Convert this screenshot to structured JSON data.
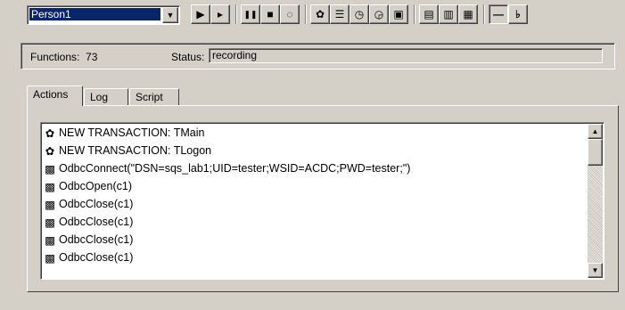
{
  "toolbar": {
    "person_value": "Person1",
    "buttons": [
      {
        "name": "play-icon",
        "glyph": "▶"
      },
      {
        "name": "step-play-icon",
        "glyph": "▸"
      },
      {
        "name": "pause-icon",
        "glyph": "❚❚"
      },
      {
        "name": "stop-icon",
        "glyph": "■"
      },
      {
        "name": "record-icon",
        "glyph": "◌"
      },
      {
        "name": "gears-icon",
        "glyph": "✿"
      },
      {
        "name": "properties-icon",
        "glyph": "☰"
      },
      {
        "name": "timer-icon",
        "glyph": "◷"
      },
      {
        "name": "timer-end-icon",
        "glyph": "◶"
      },
      {
        "name": "window-icon",
        "glyph": "▣"
      },
      {
        "name": "report-icon",
        "glyph": "▤"
      },
      {
        "name": "document-icon",
        "glyph": "▥"
      },
      {
        "name": "script-icon",
        "glyph": "▦"
      },
      {
        "name": "minimize-icon",
        "glyph": "—"
      },
      {
        "name": "pin-icon",
        "glyph": "♭"
      }
    ]
  },
  "info": {
    "functions_label": "Functions:",
    "functions_value": "73",
    "status_label": "Status:",
    "status_value": "recording"
  },
  "tabs": [
    {
      "label": "Actions"
    },
    {
      "label": "Log"
    },
    {
      "label": "Script"
    }
  ],
  "actions": [
    {
      "icon": "transaction-icon",
      "text": "NEW TRANSACTION: TMain"
    },
    {
      "icon": "transaction-icon",
      "text": "NEW TRANSACTION: TLogon"
    },
    {
      "icon": "odbc-icon",
      "text": "OdbcConnect(\"DSN=sqs_lab1;UID=tester;WSID=ACDC;PWD=tester;\")"
    },
    {
      "icon": "odbc-icon",
      "text": "OdbcOpen(c1)"
    },
    {
      "icon": "odbc-icon",
      "text": "OdbcClose(c1)"
    },
    {
      "icon": "odbc-icon",
      "text": "OdbcClose(c1)"
    },
    {
      "icon": "odbc-icon",
      "text": "OdbcClose(c1)"
    },
    {
      "icon": "odbc-icon",
      "text": "OdbcClose(c1)"
    }
  ],
  "colors": {
    "face": "#d4d0c8",
    "selection": "#0a246a"
  }
}
